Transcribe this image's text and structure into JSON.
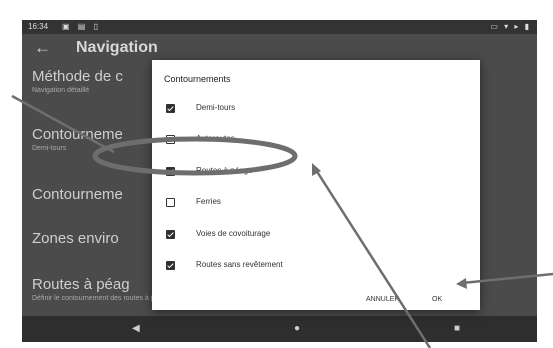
{
  "status_bar": {
    "time": "16:34",
    "left_icons": "▣ ▤ ▯",
    "right_icons": "▭ ▾ ▸ ▮"
  },
  "app": {
    "title": "Navigation"
  },
  "settings": [
    {
      "title": "Méthode de c",
      "subtitle": "Navigation détaillé"
    },
    {
      "title": "Contourneme",
      "subtitle": "Demi-tours"
    },
    {
      "title": "Contourneme",
      "subtitle": ""
    },
    {
      "title": "Zones enviro",
      "subtitle": ""
    },
    {
      "title": "Routes à péag",
      "subtitle": "Définir le contournement des routes à péage"
    }
  ],
  "dialog": {
    "title": "Contournements",
    "options": [
      {
        "label": "Demi-tours",
        "checked": true
      },
      {
        "label": "Autoroutes",
        "checked": false
      },
      {
        "label": "Routes à péage",
        "checked": true
      },
      {
        "label": "Ferries",
        "checked": false
      },
      {
        "label": "Voies de covoiturage",
        "checked": true
      },
      {
        "label": "Routes sans revêtement",
        "checked": true
      }
    ],
    "cancel_label": "ANNULER",
    "ok_label": "OK"
  },
  "nav_bar": {
    "back": "◀",
    "home": "●",
    "recents": "■"
  },
  "colors": {
    "background": "#ffffff",
    "screen_dim": "#4b4b4b",
    "dialog": "#ffffff",
    "annotation": "#6e6e6e"
  }
}
